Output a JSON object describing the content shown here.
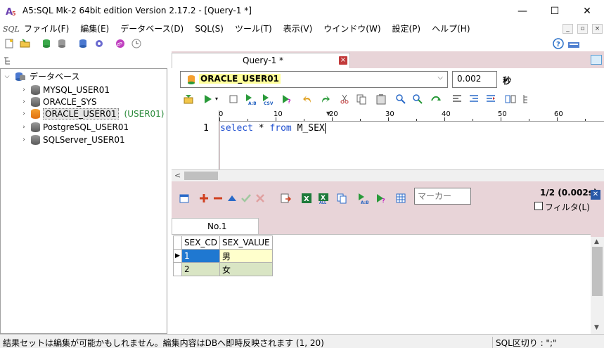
{
  "window": {
    "title": "A5:SQL Mk-2 64bit edition Version 2.17.2 - [Query-1 *]",
    "minimize": "—",
    "maximize": "☐",
    "close": "✕"
  },
  "menu": {
    "logo": "SQL",
    "items": [
      "ファイル(F)",
      "編集(E)",
      "データベース(D)",
      "SQL(S)",
      "ツール(T)",
      "表示(V)",
      "ウインドウ(W)",
      "設定(P)",
      "ヘルプ(H)"
    ],
    "mdi_buttons": [
      "_",
      "▫",
      "×"
    ]
  },
  "tree": {
    "root_label": "データベース",
    "items": [
      {
        "label": "MYSQL_USER01",
        "toggle": "›"
      },
      {
        "label": "ORACLE_SYS",
        "toggle": "›"
      },
      {
        "label": "ORACLE_USER01",
        "toggle": "›",
        "user": "(USER01)"
      },
      {
        "label": "PostgreSQL_USER01",
        "toggle": "›"
      },
      {
        "label": "SQLServer_USER01",
        "toggle": "›"
      }
    ]
  },
  "editor": {
    "tab_label": "Query-1 *",
    "tab_close": "×",
    "connection": "ORACLE_USER01",
    "connection_arrow": "⌵",
    "time_value": "0.002",
    "time_unit": "秒",
    "ruler": [
      "0",
      "10",
      "20",
      "30",
      "40",
      "50",
      "60"
    ],
    "line_number": "1",
    "code": {
      "kw1": "select",
      "star": "*",
      "kw2": "from",
      "table": "M_SEX"
    },
    "scroll_left": "<"
  },
  "result": {
    "marker_placeholder": "マーカー",
    "page_info": "1/2 (0.002s)",
    "filter_label": "フィルタ(L)",
    "close": "✕",
    "tab_label": "No.1",
    "columns": [
      "SEX_CD",
      "SEX_VALUE"
    ],
    "rows": [
      {
        "cd": "1",
        "value": "男"
      },
      {
        "cd": "2",
        "value": "女"
      }
    ],
    "row_indicator": "▶",
    "scroll_up": "▲",
    "scroll_down": "▼"
  },
  "status": {
    "left": "結果セットは編集が可能かもしれません。編集内容はDBへ即時反映されます (1, 20)",
    "right": "SQL区切り : \";\""
  },
  "colors": {
    "pane_bg": "#e8d4d8",
    "keyword": "#2050d0",
    "selected_cell": "#1f78d1",
    "highlight": "#ffff99"
  }
}
